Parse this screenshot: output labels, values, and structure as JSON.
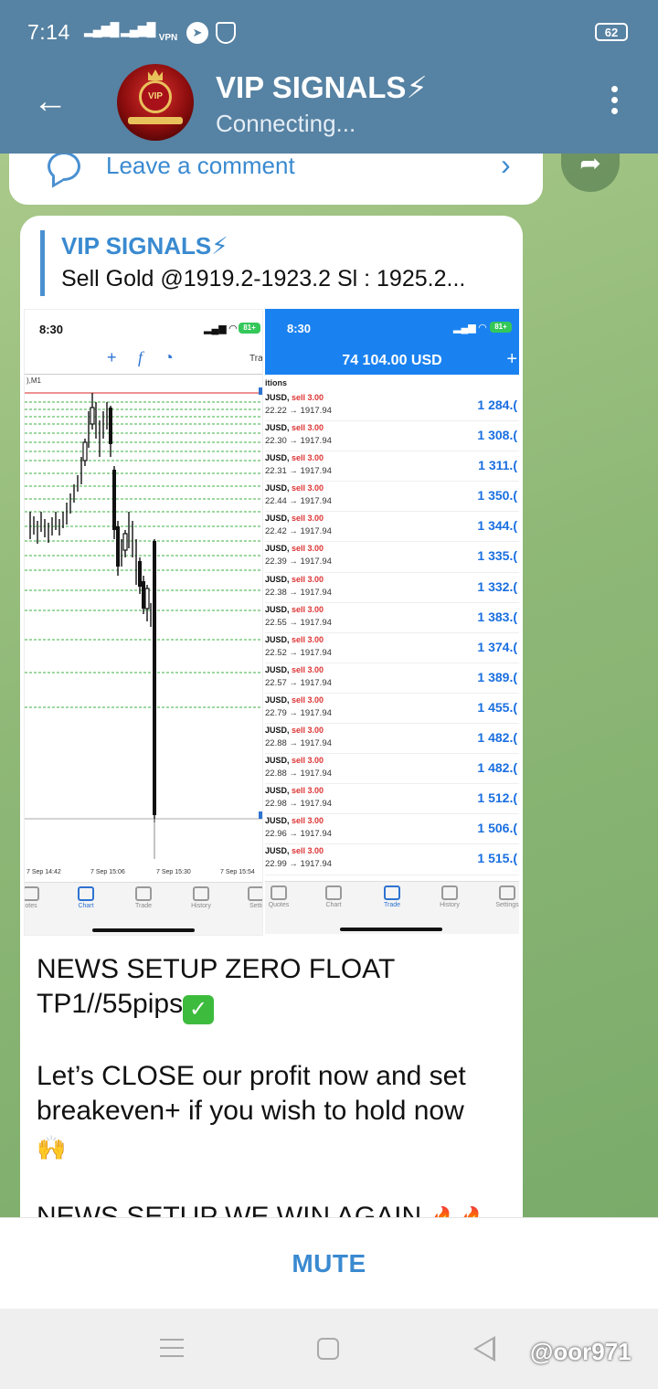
{
  "statusbar": {
    "time": "7:14",
    "signal_primary_label": "ᴴ",
    "vpn_label": "VPN",
    "battery": "62"
  },
  "header": {
    "title": "VIP SIGNALS⚡",
    "status": "Connecting...",
    "avatar_text": "VIP"
  },
  "comment": {
    "label": "Leave a comment"
  },
  "post": {
    "reply_title": "VIP SIGNALS⚡",
    "reply_text": "Sell Gold @1919.2-1923.2  Sl : 1925.2...",
    "message_line1": "NEWS SETUP ZERO FLOAT",
    "message_line2": "TP1//55pips",
    "message_line3": "Let’s CLOSE our profit now and set breakeven+ if you wish to hold now",
    "message_line4": "NEWS SETUP WE WIN AGAIN"
  },
  "left_screenshot": {
    "time": "8:30",
    "battery": "81+",
    "toolbar_cut": "Tra",
    "timeframe": "),M1",
    "x_labels": [
      "7 Sep 14:42",
      "7 Sep 15:06",
      "7 Sep 15:30",
      "7 Sep 15:54"
    ],
    "tabs": [
      {
        "label": "otes",
        "active": false
      },
      {
        "label": "Chart",
        "active": true
      },
      {
        "label": "Trade",
        "active": false
      },
      {
        "label": "History",
        "active": false
      },
      {
        "label": "Setti",
        "active": false
      }
    ]
  },
  "right_screenshot": {
    "time": "8:30",
    "battery": "81+",
    "balance": "74 104.00 USD",
    "positions_label": "itions",
    "positions": [
      {
        "symbol": "JUSD,",
        "side": "sell 3.00",
        "prices": "22.22 → 1917.94",
        "profit": "1 284.("
      },
      {
        "symbol": "JUSD,",
        "side": "sell 3.00",
        "prices": "22.30 → 1917.94",
        "profit": "1 308.("
      },
      {
        "symbol": "JUSD,",
        "side": "sell 3.00",
        "prices": "22.31 → 1917.94",
        "profit": "1 311.("
      },
      {
        "symbol": "JUSD,",
        "side": "sell 3.00",
        "prices": "22.44 → 1917.94",
        "profit": "1 350.("
      },
      {
        "symbol": "JUSD,",
        "side": "sell 3.00",
        "prices": "22.42 → 1917.94",
        "profit": "1 344.("
      },
      {
        "symbol": "JUSD,",
        "side": "sell 3.00",
        "prices": "22.39 → 1917.94",
        "profit": "1 335.("
      },
      {
        "symbol": "JUSD,",
        "side": "sell 3.00",
        "prices": "22.38 → 1917.94",
        "profit": "1 332.("
      },
      {
        "symbol": "JUSD,",
        "side": "sell 3.00",
        "prices": "22.55 → 1917.94",
        "profit": "1 383.("
      },
      {
        "symbol": "JUSD,",
        "side": "sell 3.00",
        "prices": "22.52 → 1917.94",
        "profit": "1 374.("
      },
      {
        "symbol": "JUSD,",
        "side": "sell 3.00",
        "prices": "22.57 → 1917.94",
        "profit": "1 389.("
      },
      {
        "symbol": "JUSD,",
        "side": "sell 3.00",
        "prices": "22.79 → 1917.94",
        "profit": "1 455.("
      },
      {
        "symbol": "JUSD,",
        "side": "sell 3.00",
        "prices": "22.88 → 1917.94",
        "profit": "1 482.("
      },
      {
        "symbol": "JUSD,",
        "side": "sell 3.00",
        "prices": "22.88 → 1917.94",
        "profit": "1 482.("
      },
      {
        "symbol": "JUSD,",
        "side": "sell 3.00",
        "prices": "22.98 → 1917.94",
        "profit": "1 512.("
      },
      {
        "symbol": "JUSD,",
        "side": "sell 3.00",
        "prices": "22.96 → 1917.94",
        "profit": "1 506.("
      },
      {
        "symbol": "JUSD,",
        "side": "sell 3.00",
        "prices": "22.99 → 1917.94",
        "profit": "1 515.("
      }
    ],
    "tabs": [
      {
        "label": "Quotes",
        "active": false
      },
      {
        "label": "Chart",
        "active": false
      },
      {
        "label": "Trade",
        "active": true
      },
      {
        "label": "History",
        "active": false
      },
      {
        "label": "Settings",
        "active": false
      }
    ]
  },
  "bottom": {
    "mute_label": "MUTE",
    "watermark": "@oor971"
  },
  "colors": {
    "header": "#5682a3",
    "accent": "#3a8ad0",
    "mt_blue": "#1a82f0",
    "sell_red": "#d33333"
  }
}
